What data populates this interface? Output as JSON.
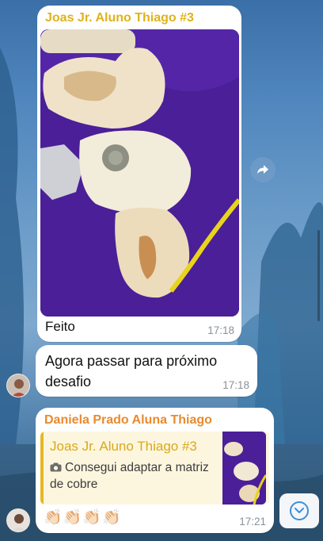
{
  "chat": {
    "messages": [
      {
        "sender": "Joas Jr. Aluno Thiago #3",
        "sender_color": "#e0b21c",
        "caption": "Feito",
        "time": "17:18"
      },
      {
        "text": "Agora passar para próximo desafio",
        "time": "17:18"
      },
      {
        "sender": "Daniela Prado Aluna Thiago",
        "sender_color": "#e98a2d",
        "reply": {
          "name": "Joas Jr. Aluno Thiago #3",
          "text": "Consegui adaptar a matriz de cobre",
          "icon": "camera-icon"
        },
        "emojis": "👏🏻👏🏻👏🏻👏🏻",
        "time": "17:21"
      }
    ]
  },
  "controls": {
    "forward_icon": "forward-arrow-icon",
    "scroll_down_icon": "chevron-down-icon"
  }
}
